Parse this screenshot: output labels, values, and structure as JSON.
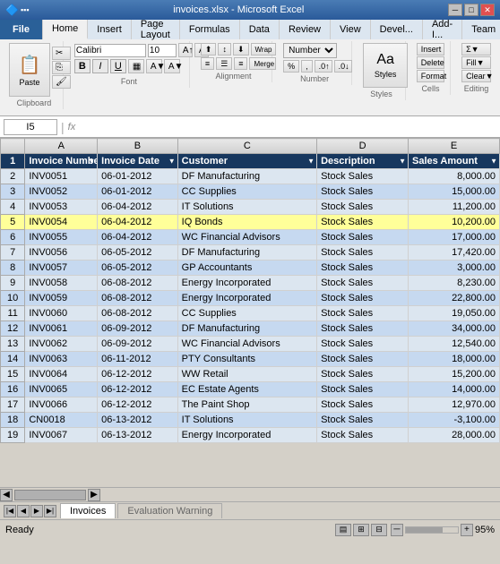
{
  "window": {
    "title": "invoices.xlsx - Microsoft Excel",
    "minimize": "─",
    "maximize": "□",
    "close": "✕"
  },
  "ribbon": {
    "tabs": [
      "File",
      "Home",
      "Insert",
      "Page Layout",
      "Formulas",
      "Data",
      "Review",
      "View",
      "Developer",
      "Add-Ins",
      "Team"
    ],
    "active_tab": "Home",
    "font_name": "Calibri",
    "font_size": "10",
    "clipboard_label": "Clipboard",
    "font_label": "Font",
    "alignment_label": "Alignment",
    "number_label": "Number",
    "styles_label": "Styles",
    "cells_label": "Cells",
    "editing_label": "Editing"
  },
  "formula_bar": {
    "cell_ref": "I5",
    "fx": "fx",
    "formula": ""
  },
  "columns": {
    "headers": [
      "",
      "A",
      "B",
      "C",
      "D",
      "E"
    ],
    "col_a_header": "Invoice Number",
    "col_b_header": "Invoice Date",
    "col_c_header": "Customer",
    "col_d_header": "Description",
    "col_e_header": "Sales Amount"
  },
  "rows": [
    {
      "num": "2",
      "a": "INV0051",
      "b": "06-01-2012",
      "c": "DF Manufacturing",
      "d": "Stock Sales",
      "e": "8,000.00",
      "selected": false
    },
    {
      "num": "3",
      "a": "INV0052",
      "b": "06-01-2012",
      "c": "CC Supplies",
      "d": "Stock Sales",
      "e": "15,000.00",
      "selected": false
    },
    {
      "num": "4",
      "a": "INV0053",
      "b": "06-04-2012",
      "c": "IT Solutions",
      "d": "Stock Sales",
      "e": "11,200.00",
      "selected": false
    },
    {
      "num": "5",
      "a": "INV0054",
      "b": "06-04-2012",
      "c": "IQ Bonds",
      "d": "Stock Sales",
      "e": "10,200.00",
      "selected": true
    },
    {
      "num": "6",
      "a": "INV0055",
      "b": "06-04-2012",
      "c": "WC Financial Advisors",
      "d": "Stock Sales",
      "e": "17,000.00",
      "selected": false
    },
    {
      "num": "7",
      "a": "INV0056",
      "b": "06-05-2012",
      "c": "DF Manufacturing",
      "d": "Stock Sales",
      "e": "17,420.00",
      "selected": false
    },
    {
      "num": "8",
      "a": "INV0057",
      "b": "06-05-2012",
      "c": "GP Accountants",
      "d": "Stock Sales",
      "e": "3,000.00",
      "selected": false
    },
    {
      "num": "9",
      "a": "INV0058",
      "b": "06-08-2012",
      "c": "Energy Incorporated",
      "d": "Stock Sales",
      "e": "8,230.00",
      "selected": false
    },
    {
      "num": "10",
      "a": "INV0059",
      "b": "06-08-2012",
      "c": "Energy Incorporated",
      "d": "Stock Sales",
      "e": "22,800.00",
      "selected": false
    },
    {
      "num": "11",
      "a": "INV0060",
      "b": "06-08-2012",
      "c": "CC Supplies",
      "d": "Stock Sales",
      "e": "19,050.00",
      "selected": false
    },
    {
      "num": "12",
      "a": "INV0061",
      "b": "06-09-2012",
      "c": "DF Manufacturing",
      "d": "Stock Sales",
      "e": "34,000.00",
      "selected": false
    },
    {
      "num": "13",
      "a": "INV0062",
      "b": "06-09-2012",
      "c": "WC Financial Advisors",
      "d": "Stock Sales",
      "e": "12,540.00",
      "selected": false
    },
    {
      "num": "14",
      "a": "INV0063",
      "b": "06-11-2012",
      "c": "PTY Consultants",
      "d": "Stock Sales",
      "e": "18,000.00",
      "selected": false
    },
    {
      "num": "15",
      "a": "INV0064",
      "b": "06-12-2012",
      "c": "WW Retail",
      "d": "Stock Sales",
      "e": "15,200.00",
      "selected": false
    },
    {
      "num": "16",
      "a": "INV0065",
      "b": "06-12-2012",
      "c": "EC Estate Agents",
      "d": "Stock Sales",
      "e": "14,000.00",
      "selected": false
    },
    {
      "num": "17",
      "a": "INV0066",
      "b": "06-12-2012",
      "c": "The Paint Shop",
      "d": "Stock Sales",
      "e": "12,970.00",
      "selected": false
    },
    {
      "num": "18",
      "a": "CN0018",
      "b": "06-13-2012",
      "c": "IT Solutions",
      "d": "Stock Sales",
      "e": "-3,100.00",
      "selected": false,
      "credit": true
    },
    {
      "num": "19",
      "a": "INV0067",
      "b": "06-13-2012",
      "c": "Energy Incorporated",
      "d": "Stock Sales",
      "e": "28,000.00",
      "selected": false
    }
  ],
  "sheet_tabs": {
    "active": "Invoices",
    "inactive": "Evaluation Warning"
  },
  "status_bar": {
    "ready": "Ready",
    "zoom": "95%"
  }
}
